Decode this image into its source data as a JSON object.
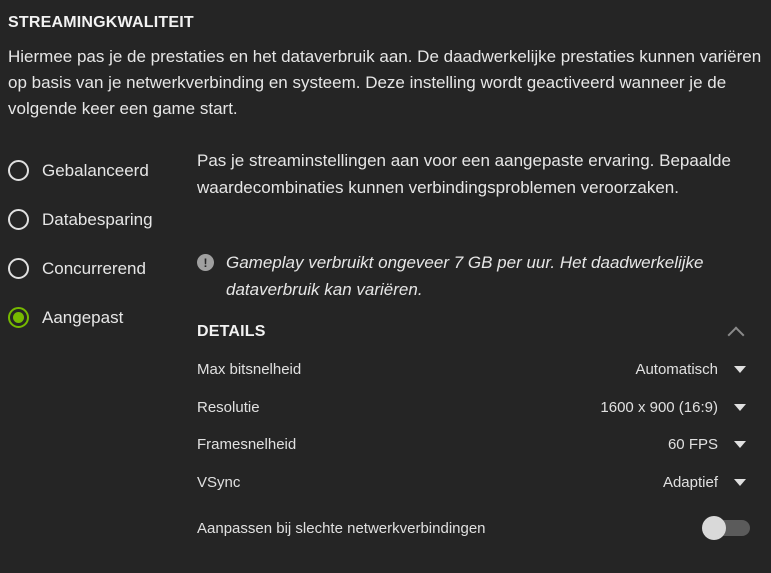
{
  "section": {
    "title": "STREAMINGKWALITEIT",
    "description": "Hiermee pas je de prestaties en het dataverbruik aan. De daadwerkelijke prestaties kunnen variëren op basis van je netwerkverbinding en systeem. Deze instelling wordt geactiveerd wanneer je de volgende keer een game start."
  },
  "quality_options": [
    {
      "label": "Gebalanceerd",
      "selected": false
    },
    {
      "label": "Databesparing",
      "selected": false
    },
    {
      "label": "Concurrerend",
      "selected": false
    },
    {
      "label": "Aangepast",
      "selected": true
    }
  ],
  "custom": {
    "description": "Pas je streaminstellingen aan voor een aangepaste ervaring. Bepaalde waardecombinaties kunnen verbindingsproblemen veroorzaken.",
    "info_icon_glyph": "!",
    "info": "Gameplay verbruikt ongeveer 7 GB per uur. Het daadwerkelijke dataverbruik kan variëren."
  },
  "details": {
    "title": "DETAILS",
    "settings": [
      {
        "label": "Max bitsnelheid",
        "value": "Automatisch"
      },
      {
        "label": "Resolutie",
        "value": "1600 x 900 (16:9)"
      },
      {
        "label": "Framesnelheid",
        "value": "60 FPS"
      },
      {
        "label": "VSync",
        "value": "Adaptief"
      }
    ],
    "toggle_label": "Aanpassen bij slechte netwerkverbindingen",
    "toggle_on": false
  },
  "colors": {
    "background": "#252525",
    "accent": "#76b900",
    "text": "#e6e6e6"
  }
}
